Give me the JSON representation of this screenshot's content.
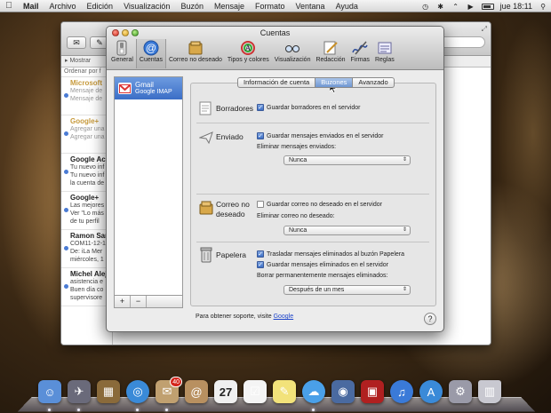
{
  "menubar": {
    "app_name": "Mail",
    "items": [
      "Archivo",
      "Edición",
      "Visualización",
      "Buzón",
      "Mensaje",
      "Formato",
      "Ventana",
      "Ayuda"
    ],
    "clock": "jue 18:11"
  },
  "mail_window": {
    "show_label": "Mostrar",
    "sort_label": "Ordenar por f",
    "messages": [
      {
        "sender": "Microsoft ",
        "lines": [
          "Mensaje de",
          "Mensaje de"
        ],
        "dim": true
      },
      {
        "sender": "Google+ ",
        "lines": [
          "Agregar una",
          "Agregar una"
        ],
        "dim": true
      },
      {
        "sender": "Google Acc",
        "lines": [
          "Tu nuevo inf",
          "Tu nuevo inf",
          "la cuenta de"
        ],
        "dim": false
      },
      {
        "sender": "Google+",
        "lines": [
          "Las mejores",
          "Ver \"Lo más",
          "de tu perfil"
        ],
        "dim": false
      },
      {
        "sender": "Ramon Sar",
        "lines": [
          "COM11-12-1",
          "De: iLa Mer",
          "miércoles, 1"
        ],
        "dim": false
      },
      {
        "sender": "Michel Alej",
        "lines": [
          "asistencia e",
          "Buen día co",
          "supervisore"
        ],
        "dim": false
      }
    ]
  },
  "prefs": {
    "title": "Cuentas",
    "toolbar": [
      {
        "label": "General",
        "icon": "switch-icon"
      },
      {
        "label": "Cuentas",
        "icon": "at-icon"
      },
      {
        "label": "Correo no deseado",
        "icon": "junk-icon"
      },
      {
        "label": "Tipos y colores",
        "icon": "fonts-colors-icon"
      },
      {
        "label": "Visualización",
        "icon": "glasses-icon"
      },
      {
        "label": "Redacción",
        "icon": "compose-icon"
      },
      {
        "label": "Firmas",
        "icon": "signature-icon"
      },
      {
        "label": "Reglas",
        "icon": "rules-icon"
      }
    ],
    "selected_tool": "Cuentas",
    "account": {
      "name": "Gmail",
      "type": "Google IMAP"
    },
    "add_label": "+",
    "remove_label": "−",
    "tabs": [
      "Información de cuenta",
      "Buzones",
      "Avanzado"
    ],
    "active_tab": "Buzones",
    "sections": {
      "drafts": {
        "title": "Borradores",
        "checkbox": "Guardar borradores en el servidor",
        "checked": true
      },
      "sent": {
        "title": "Enviado",
        "checkbox": "Guardar mensajes enviados en el servidor",
        "checked": true,
        "field_label": "Eliminar mensajes enviados:",
        "select_value": "Nunca"
      },
      "junk": {
        "title_line1": "Correo no",
        "title_line2": "deseado",
        "checkbox": "Guardar correo no deseado en el servidor",
        "checked": false,
        "field_label": "Eliminar correo no deseado:",
        "select_value": "Nunca"
      },
      "trash": {
        "title": "Papelera",
        "checkbox1": "Trasladar mensajes eliminados al buzón Papelera",
        "checked1": true,
        "checkbox2": "Guardar mensajes eliminados en el servidor",
        "checked2": true,
        "field_label": "Borrar permanentemente mensajes eliminados:",
        "select_value": "Después de un mes"
      }
    },
    "support_text": "Para obtener soporte, visite ",
    "support_link": "Google",
    "help_label": "?"
  },
  "dock": {
    "icons": [
      "finder-icon",
      "launchpad-icon",
      "mission-control-icon",
      "safari-icon",
      "mail-icon",
      "contacts-icon",
      "calendar-icon",
      "reminders-icon",
      "notes-icon",
      "messages-icon",
      "facetime-icon",
      "photo-booth-icon",
      "itunes-icon",
      "app-store-icon",
      "system-preferences-icon",
      "trash-icon"
    ],
    "calendar_day": "27",
    "mail_badge": "40"
  },
  "colors": {
    "selection_blue": "#3b6ec6",
    "link_blue": "#1d44c9"
  }
}
